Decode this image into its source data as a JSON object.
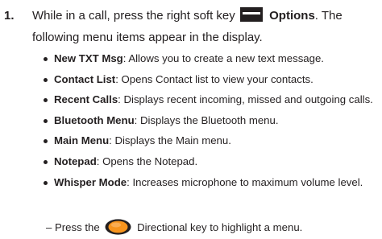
{
  "step": {
    "number": "1.",
    "line1_a": "While in a call, press the right soft key",
    "key_label": "Options",
    "line1_b": ". The",
    "line2": "following menu items appear in the display.",
    "softkey_icon": "right-soft-key-icon"
  },
  "menu_items": [
    {
      "name": "New TXT Msg",
      "desc": ": Allows you to create a new text message."
    },
    {
      "name": "Contact List",
      "desc": ": Opens Contact list to view your contacts."
    },
    {
      "name": "Recent Calls",
      "desc": ": Displays recent incoming, missed and outgoing calls."
    },
    {
      "name": "Bluetooth Menu",
      "desc": ": Displays the Bluetooth menu."
    },
    {
      "name": "Main Menu",
      "desc": ": Displays the Main menu."
    },
    {
      "name": "Notepad",
      "desc": ": Opens the Notepad."
    },
    {
      "name": "Whisper Mode",
      "desc": ": Increases microphone to maximum volume level."
    }
  ],
  "sub": {
    "prefix": "– Press the",
    "suffix": "Directional key to highlight a menu.",
    "icon": "directional-key-icon"
  }
}
